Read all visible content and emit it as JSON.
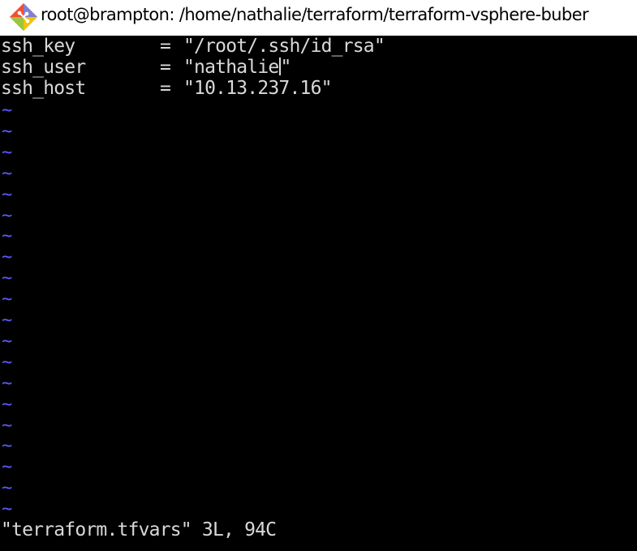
{
  "window": {
    "title": "root@brampton: /home/nathalie/terraform/terraform-vsphere-buber",
    "icon": "git-bash-diamond-icon"
  },
  "editor": {
    "lines": [
      {
        "key": "ssh_key",
        "equals": "=",
        "value": "\"/root/.ssh/id_rsa\""
      },
      {
        "key": "ssh_user",
        "equals": "=",
        "value_before_cursor": "\"nathalie",
        "value_after_cursor": "\""
      },
      {
        "key": "ssh_host",
        "equals": "=",
        "value": "\"10.13.237.16\""
      }
    ],
    "empty_line_marker": "~",
    "empty_line_count": 20
  },
  "status_bar": {
    "message": "\"terraform.tfvars\" 3L, 94C"
  },
  "colors": {
    "background": "#000000",
    "text": "#d9d9d9",
    "tilde": "#5c5cff",
    "titlebar": "#ffffff"
  }
}
